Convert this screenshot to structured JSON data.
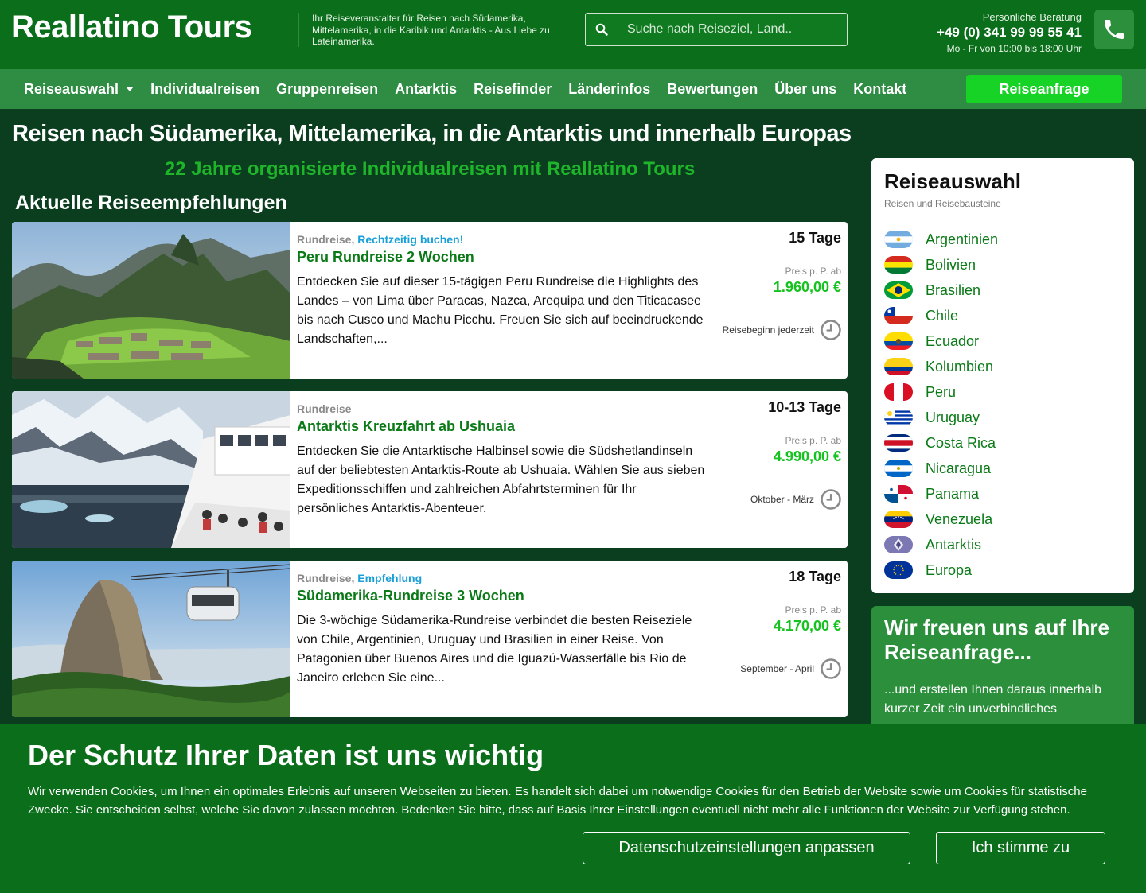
{
  "header": {
    "logo": "Reallatino Tours",
    "tagline": "Ihr Reiseveranstalter für Reisen nach Südamerika, Mittelamerika, in die Karibik und Antarktis - Aus Liebe zu Lateinamerika.",
    "search_placeholder": "Suche nach Reiseziel, Land..",
    "contact_label": "Persönliche Beratung",
    "phone": "+49 (0) 341 99 99 55 41",
    "hours": "Mo - Fr von 10:00 bis 18:00 Uhr"
  },
  "nav": {
    "items": [
      "Reiseauswahl",
      "Individualreisen",
      "Gruppenreisen",
      "Antarktis",
      "Reisefinder",
      "Länderinfos",
      "Bewertungen",
      "Über uns",
      "Kontakt"
    ],
    "cta": "Reiseanfrage"
  },
  "main": {
    "headline": "Reisen nach Südamerika, Mittelamerika, in die Antarktis und innerhalb Europas",
    "subheadline": "22 Jahre organisierte Individualreisen mit Reallatino Tours",
    "section_title": "Aktuelle Reiseempfehlungen",
    "price_label": "Preis p. P. ab",
    "tours": [
      {
        "category": "Rundreise",
        "highlight": "Rechtzeitig buchen!",
        "title": "Peru Rundreise 2 Wochen",
        "description": "Entdecken Sie auf dieser 15-tägigen Peru Rundreise die Highlights des Landes – von Lima über Paracas, Nazca, Arequipa und den Titicacasee bis nach Cusco und Machu Picchu. Freuen Sie sich auf beeindruckende Landschaften,...",
        "duration": "15 Tage",
        "price": "1.960,00 €",
        "start": "Reisebeginn jederzeit"
      },
      {
        "category": "Rundreise",
        "highlight": "",
        "title": "Antarktis Kreuzfahrt ab Ushuaia",
        "description": "Entdecken Sie die Antarktische Halbinsel sowie die Südshetlandinseln auf der beliebtesten Antarktis-Route ab Ushuaia. Wählen Sie aus sieben Expeditionsschiffen und zahlreichen Abfahrtsterminen für Ihr persönliches Antarktis-Abenteuer.",
        "duration": "10-13 Tage",
        "price": "4.990,00 €",
        "start": "Oktober - März"
      },
      {
        "category": "Rundreise",
        "highlight": "Empfehlung",
        "title": "Südamerika-Rundreise 3 Wochen",
        "description": "Die 3-wöchige Südamerika-Rundreise verbindet die besten Reiseziele von Chile, Argentinien, Uruguay und Brasilien in einer Reise. Von Patagonien über Buenos Aires und die Iguazú-Wasserfälle bis Rio de Janeiro erleben Sie eine...",
        "duration": "18 Tage",
        "price": "4.170,00 €",
        "start": "September - April"
      }
    ]
  },
  "sidebar": {
    "title": "Reiseauswahl",
    "subtitle": "Reisen und Reisebausteine",
    "countries": [
      "Argentinien",
      "Bolivien",
      "Brasilien",
      "Chile",
      "Ecuador",
      "Kolumbien",
      "Peru",
      "Uruguay",
      "Costa Rica",
      "Nicaragua",
      "Panama",
      "Venezuela",
      "Antarktis",
      "Europa"
    ],
    "cta_title": "Wir freuen uns auf Ihre Reiseanfrage...",
    "cta_text": "...und erstellen Ihnen daraus innerhalb kurzer Zeit ein unverbindliches"
  },
  "cookie": {
    "title": "Der Schutz Ihrer Daten ist uns wichtig",
    "text": "Wir verwenden Cookies, um Ihnen ein optimales Erlebnis auf unseren Webseiten zu bieten. Es handelt sich dabei um notwendige Cookies für den Betrieb der Website sowie um Cookies für statistische Zwecke. Sie entscheiden selbst, welche Sie davon zulassen möchten. Bedenken Sie bitte, dass auf Basis Ihrer Einstellungen eventuell nicht mehr alle Funktionen der Website zur Verfügung stehen.",
    "settings_button": "Datenschutzeinstellungen anpassen",
    "agree_button": "Ich stimme zu"
  },
  "colors": {
    "header_bg": "#0a6e1a",
    "nav_bg": "#2e8c43",
    "page_bg": "#0a3e1f",
    "accent": "#17d326",
    "title_green": "#0a7a17",
    "price_green": "#16c21f",
    "highlight_blue": "#1aa0d8"
  }
}
